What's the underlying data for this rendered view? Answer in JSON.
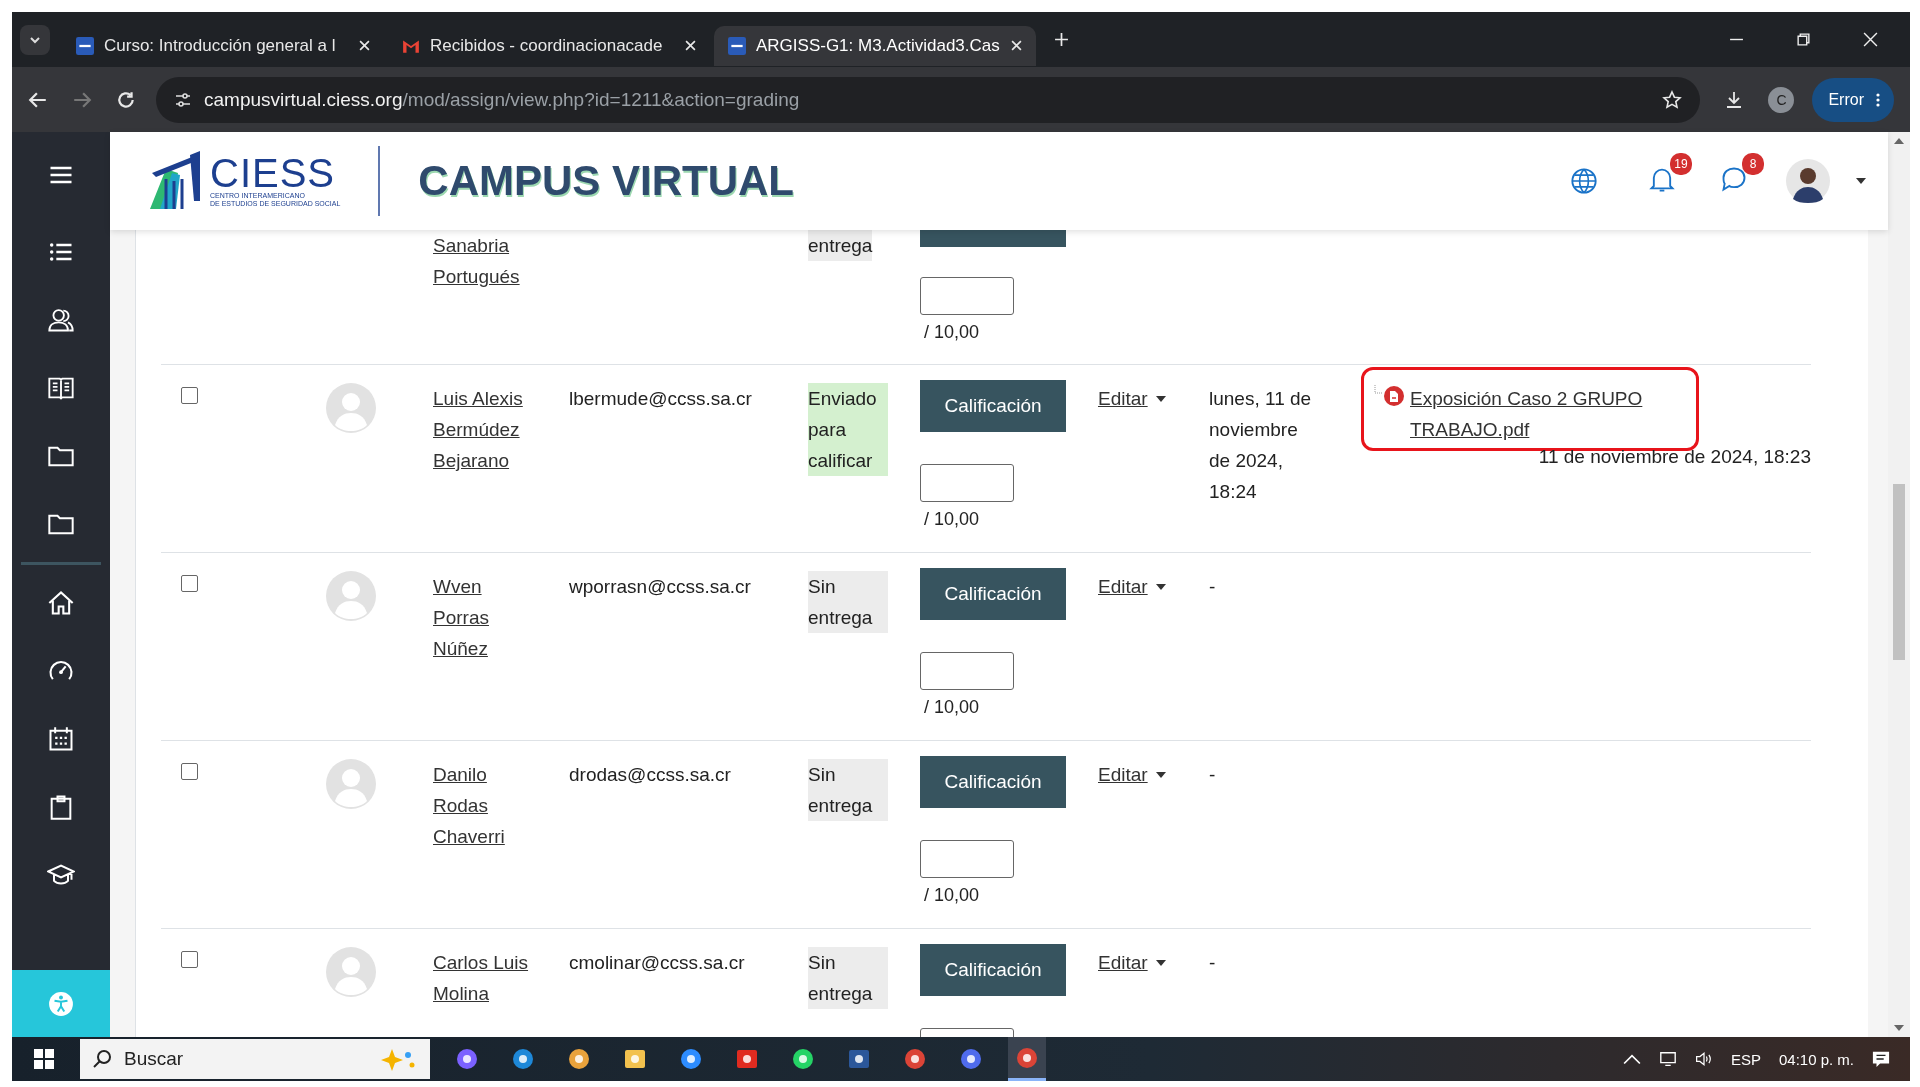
{
  "browser": {
    "tabs": [
      {
        "title": "Curso: Introducción general a l",
        "kind": "ciess",
        "selected": false
      },
      {
        "title": "Recibidos - coordinacionacade",
        "kind": "mail",
        "selected": false
      },
      {
        "title": "ARGISS-G1: M3.Actividad3.Cas",
        "kind": "ciess",
        "selected": true
      }
    ],
    "url_host": "campusvirtual.ciess.org",
    "url_path": "/mod/assign/view.php?id=1211&action=grading",
    "profile": "C",
    "error_button": "Error"
  },
  "header": {
    "logo_name": "CIESS",
    "logo_line1": "CENTRO INTERAMERICANO",
    "logo_line2": "DE ESTUDIOS DE SEGURIDAD SOCIAL",
    "site_title": "CAMPUS VIRTUAL",
    "notifications": "19",
    "messages": "8"
  },
  "sidebar": {
    "groups": [
      {
        "items": [
          {
            "kind": "list"
          },
          {
            "kind": "users"
          },
          {
            "kind": "book"
          },
          {
            "kind": "folder"
          },
          {
            "kind": "folder"
          }
        ]
      },
      {
        "items": [
          {
            "kind": "home"
          },
          {
            "kind": "gauge"
          },
          {
            "kind": "calendar"
          },
          {
            "kind": "clipboard"
          },
          {
            "kind": "graduation"
          }
        ]
      }
    ]
  },
  "rows": [
    {
      "kind": "partial",
      "name": "Sanabria Portugués",
      "status": "entrega",
      "submitted": false,
      "grade_max": "/ 10,00"
    },
    {
      "kind": "full",
      "checked": false,
      "name": "Luis Alexis Bermúdez Bejarano",
      "email": "lbermude@ccss.sa.cr",
      "status": "Enviado para calificar",
      "submitted": true,
      "grade_button": "Calificación",
      "grade_max": "/ 10,00",
      "edit": "Editar",
      "date": "lunes, 11 de noviembre de 2024, 18:24",
      "file": "Exposición Caso 2 GRUPO TRABAJO.pdf",
      "file_date": "11 de noviembre de 2024, 18:23",
      "highlighted": true
    },
    {
      "kind": "full",
      "checked": false,
      "name": "Wven Porras Núñez",
      "email": "wporrasn@ccss.sa.cr",
      "status": "Sin entrega",
      "submitted": false,
      "grade_button": "Calificación",
      "grade_max": "/ 10,00",
      "edit": "Editar",
      "date": "-"
    },
    {
      "kind": "full",
      "checked": false,
      "name": "Danilo Rodas Chaverri",
      "email": "drodas@ccss.sa.cr",
      "status": "Sin entrega",
      "submitted": false,
      "grade_button": "Calificación",
      "grade_max": "/ 10,00",
      "edit": "Editar",
      "date": "-"
    },
    {
      "kind": "full",
      "checked": false,
      "name": "Carlos Luis Molina",
      "email": "cmolinar@ccss.sa.cr",
      "status": "Sin entrega",
      "submitted": false,
      "grade_button": "Calificación",
      "edit": "Editar",
      "date": "-"
    }
  ],
  "taskbar": {
    "search": "Buscar",
    "apps": [
      {
        "kind": "copilot",
        "selected": false
      },
      {
        "kind": "edge",
        "selected": false
      },
      {
        "kind": "paint",
        "selected": false
      },
      {
        "kind": "explorer",
        "selected": false
      },
      {
        "kind": "zoom",
        "selected": false
      },
      {
        "kind": "acrobat",
        "selected": false
      },
      {
        "kind": "whatsapp",
        "selected": false
      },
      {
        "kind": "word",
        "selected": false
      },
      {
        "kind": "chrome",
        "selected": false
      },
      {
        "kind": "bing",
        "selected": false
      },
      {
        "kind": "chrome",
        "selected": true
      }
    ],
    "language": "ESP",
    "time": "04:10 p. m."
  }
}
